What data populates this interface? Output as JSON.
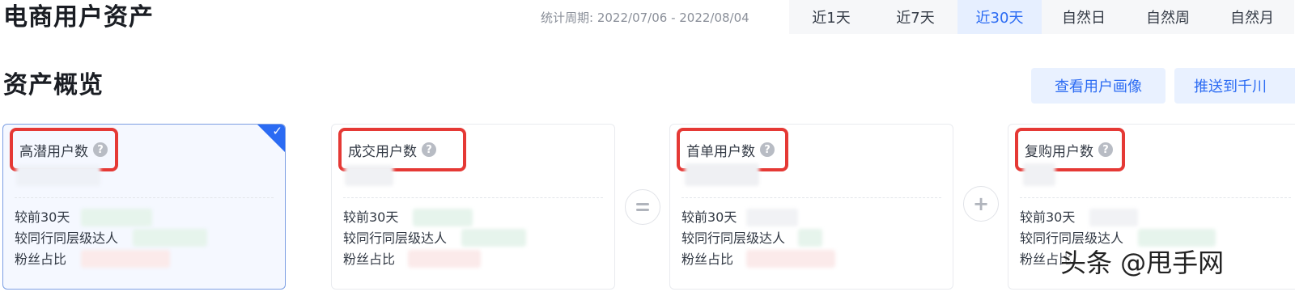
{
  "header": {
    "title": "电商用户资产",
    "period_label": "统计周期:",
    "period_value": "2022/07/06 - 2022/08/04",
    "tabs": [
      {
        "label": "近1天",
        "active": false
      },
      {
        "label": "近7天",
        "active": false
      },
      {
        "label": "近30天",
        "active": true
      },
      {
        "label": "自然日",
        "active": false
      },
      {
        "label": "自然周",
        "active": false
      },
      {
        "label": "自然月",
        "active": false
      }
    ]
  },
  "section": {
    "title": "资产概览",
    "buttons": {
      "portrait": "查看用户画像",
      "push": "推送到千川"
    }
  },
  "cards": [
    {
      "label": "高潜用户数",
      "selected": true,
      "rows": [
        "较前30天",
        "较同行同层级达人",
        "粉丝占比"
      ]
    },
    {
      "label": "成交用户数",
      "selected": false,
      "rows": [
        "较前30天",
        "较同行同层级达人",
        "粉丝占比"
      ]
    },
    {
      "label": "首单用户数",
      "selected": false,
      "rows": [
        "较前30天",
        "较同行同层级达人",
        "粉丝占比"
      ]
    },
    {
      "label": "复购用户数",
      "selected": false,
      "rows": [
        "较前30天",
        "较同行同层级达人",
        "粉丝占比"
      ]
    }
  ],
  "operators": {
    "equals": "=",
    "plus": "+"
  },
  "watermark": "头条 @甩手网",
  "icons": {
    "help": "question-circle-icon",
    "check": "check-icon"
  },
  "colors": {
    "accent": "#2b6bf3",
    "highlight_box": "#e53935",
    "tab_active_bg": "#e6efff"
  }
}
